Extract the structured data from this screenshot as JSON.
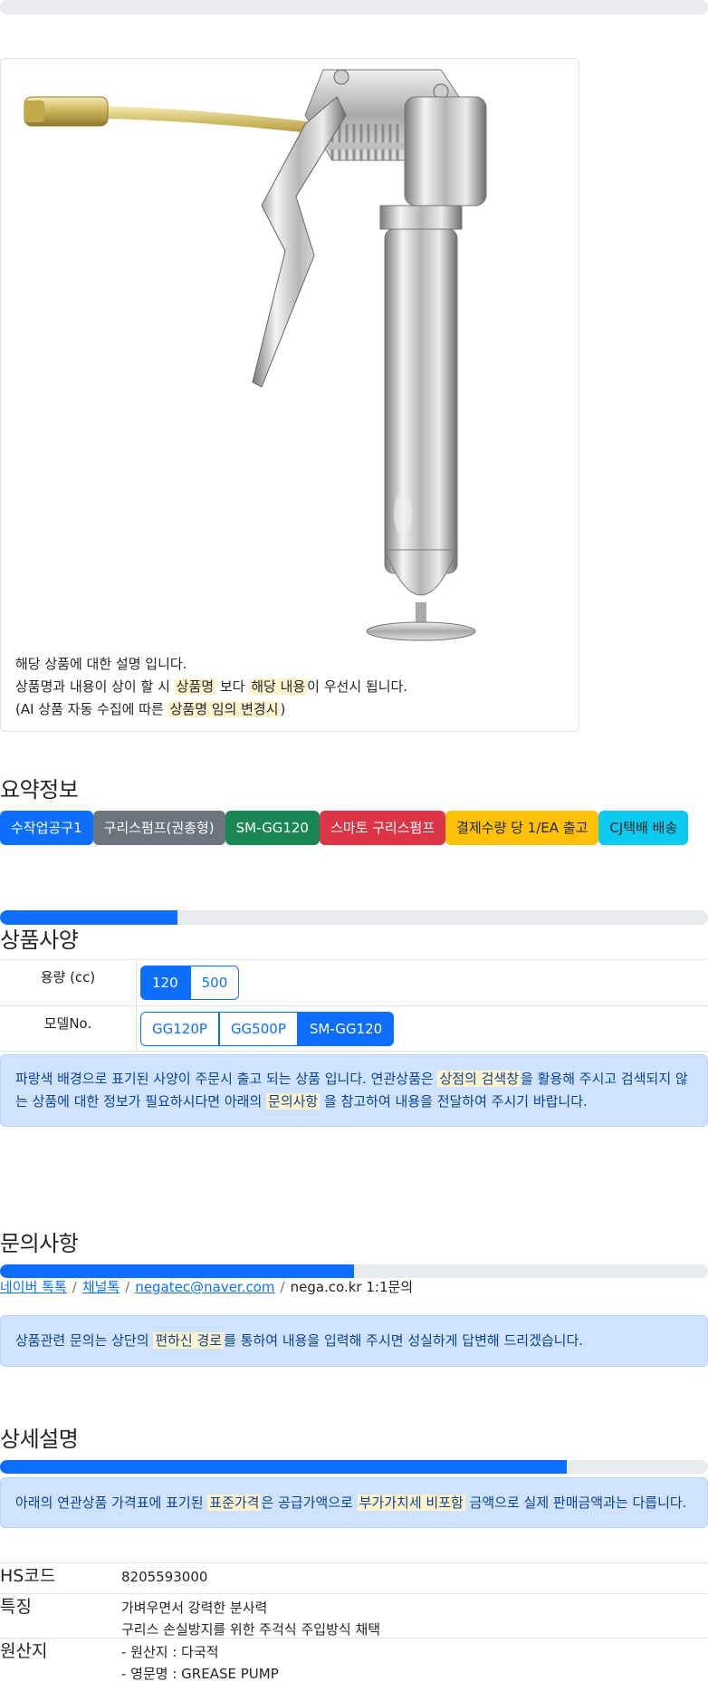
{
  "product_card": {
    "desc_line1": "해당 상품에 대한 설명 입니다.",
    "desc_line2_a": "상품명과 내용이 상이 할 시 ",
    "desc_line2_hl1": "상품명",
    "desc_line2_b": " 보다 ",
    "desc_line2_hl2": "해당 내용",
    "desc_line2_c": "이 우선시 됩니다.",
    "desc_line3_a": "(AI 상품 자동 수집에 따른 ",
    "desc_line3_hl": "상품명 임의 변경시",
    "desc_line3_b": ")"
  },
  "summary": {
    "title": "요약정보",
    "badges": [
      "수작업공구1",
      "구리스펌프(권총형)",
      "SM-GG120",
      "스마토 구리스펌프",
      "결제수량 당 1/EA 출고",
      "CJ택배 배송"
    ],
    "badge_colors": [
      "#0d6efd",
      "#6c757d",
      "#198754",
      "#dc3545",
      "#ffc107",
      "#0dcaf0"
    ]
  },
  "specs": {
    "title": "상품사양",
    "progress": 0.25,
    "rows": [
      {
        "label": "용량 (cc)",
        "options": [
          "120",
          "500"
        ],
        "selected": "120"
      },
      {
        "label": "모델No.",
        "options": [
          "GG120P",
          "GG500P",
          "SM-GG120"
        ],
        "selected": "SM-GG120"
      }
    ],
    "notice_a": "파랑색 배경으로 표기된 사양이 주문시 출고 되는 상품 입니다. 연관상품은 ",
    "notice_hl1": "상점의 검색창",
    "notice_b": "을 활용해 주시고 검색되지 않는 상품에 대한 정보가 필요하시다면 아래의 ",
    "notice_hl2": "문의사항",
    "notice_c": " 을 참고하여 내용을 전달하여 주시기 바랍니다."
  },
  "inquiry": {
    "title": "문의사항",
    "progress": 0.5,
    "links": [
      "네이버 톡톡",
      "채널톡",
      "negatec@naver.com"
    ],
    "plain": "nega.co.kr 1:1문의",
    "separator": "/",
    "notice_a": "상품관련 문의는 상단의 ",
    "notice_hl": "편하신 경로",
    "notice_b": "를 통하여 내용을 입력해 주시면 성실하게 답변해 드리겠습니다."
  },
  "details": {
    "title": "상세설명",
    "progress": 0.8,
    "notice_a": "아래의 연관상품 가격표에 표기된 ",
    "notice_hl1": "표준가격",
    "notice_b": "은 공급가액으로 ",
    "notice_hl2": "부가가치세 비포함",
    "notice_c": " 금액으로 실제 판매금액과는 다릅니다.",
    "rows": [
      {
        "label": "HS코드",
        "values": [
          "8205593000"
        ]
      },
      {
        "label": "특징",
        "values": [
          "가벼우면서 강력한 분사력",
          "구리스 손실방지를 위한 주걱식 주입방식 채택"
        ]
      },
      {
        "label": "원산지",
        "values": [
          "- 원산지 : 다국적",
          "- 영문명 : GREASE PUMP"
        ]
      }
    ]
  }
}
